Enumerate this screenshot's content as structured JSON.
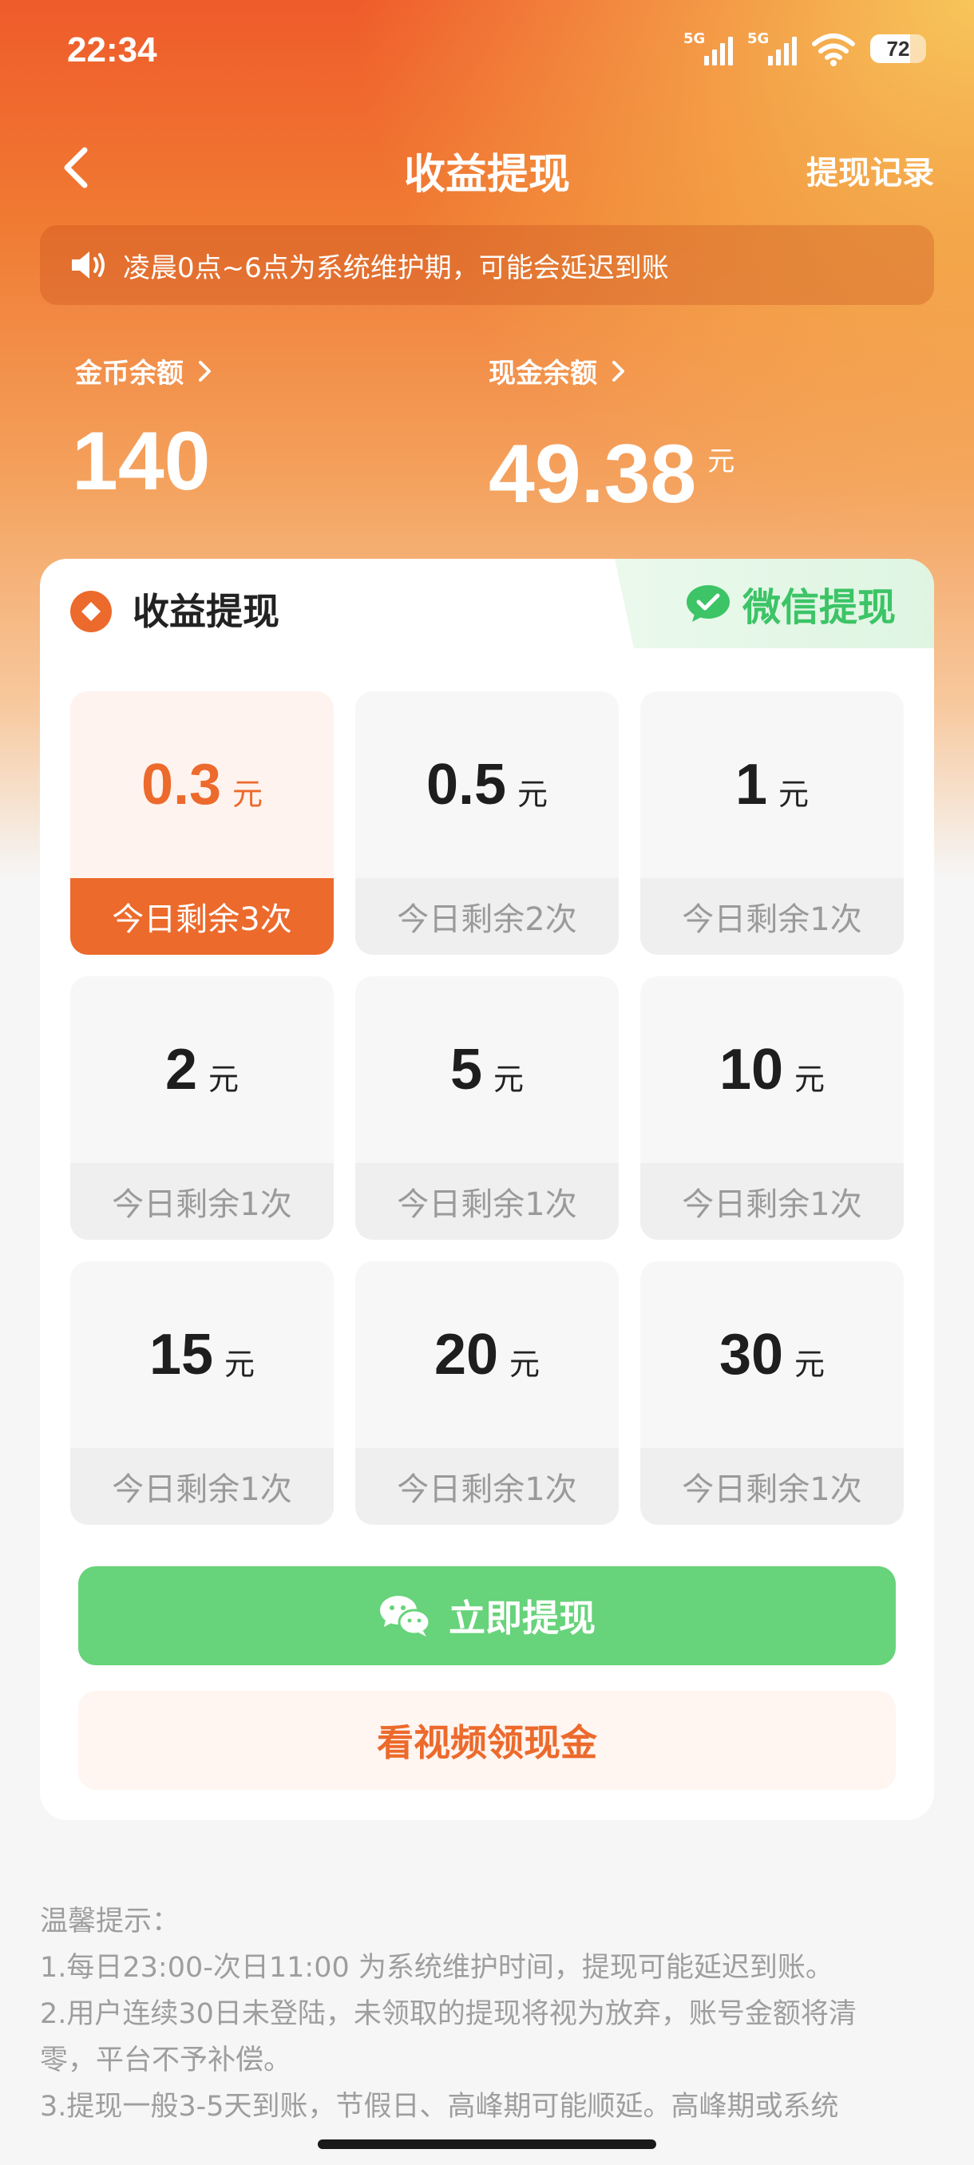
{
  "status_bar": {
    "time": "22:34",
    "signal1_label": "5G",
    "signal2_label": "5G",
    "battery": "72"
  },
  "nav": {
    "title": "收益提现",
    "record_link": "提现记录"
  },
  "notice": {
    "text": "凌晨0点~6点为系统维护期，可能会延迟到账"
  },
  "balances": {
    "coin_label": "金币余额",
    "coin_value": "140",
    "cash_label": "现金余额",
    "cash_value": "49.38",
    "cash_unit": "元"
  },
  "card": {
    "title": "收益提现",
    "wechat_tab": "微信提现",
    "unit": "元",
    "tiles": [
      {
        "amount": "0.3",
        "unit": "元",
        "remain": "今日剩余3次",
        "selected": true
      },
      {
        "amount": "0.5",
        "unit": "元",
        "remain": "今日剩余2次",
        "selected": false
      },
      {
        "amount": "1",
        "unit": "元",
        "remain": "今日剩余1次",
        "selected": false
      },
      {
        "amount": "2",
        "unit": "元",
        "remain": "今日剩余1次",
        "selected": false
      },
      {
        "amount": "5",
        "unit": "元",
        "remain": "今日剩余1次",
        "selected": false
      },
      {
        "amount": "10",
        "unit": "元",
        "remain": "今日剩余1次",
        "selected": false
      },
      {
        "amount": "15",
        "unit": "元",
        "remain": "今日剩余1次",
        "selected": false
      },
      {
        "amount": "20",
        "unit": "元",
        "remain": "今日剩余1次",
        "selected": false
      },
      {
        "amount": "30",
        "unit": "元",
        "remain": "今日剩余1次",
        "selected": false
      }
    ],
    "withdraw_button": "立即提现",
    "video_button": "看视频领现金"
  },
  "tips": {
    "heading": "温馨提示：",
    "lines": [
      "1.每日23:00-次日11:00 为系统维护时间，提现可能延迟到账。",
      "2.用户连续30日未登陆，未领取的提现将视为放弃，账号金额将清",
      "零，平台不予补偿。",
      "3.提现一般3-5天到账，节假日、高峰期可能顺延。高峰期或系统"
    ]
  },
  "colors": {
    "accent_orange": "#ec6a2c",
    "wechat_green": "#67d37a",
    "wechat_text_green": "#3cc466"
  },
  "icons": {
    "back": "chevron-left-icon",
    "notice": "speaker-icon",
    "balance_arrow": "chevron-right-icon",
    "card_head": "coin-diamond-icon",
    "wechat": "wechat-icon"
  }
}
